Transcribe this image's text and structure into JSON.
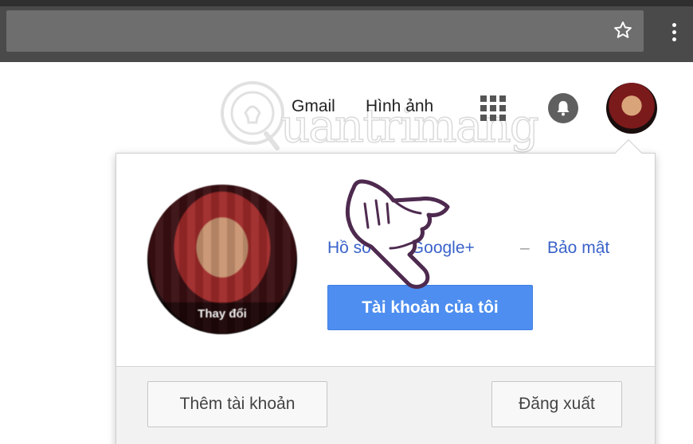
{
  "header": {
    "gmail": "Gmail",
    "images": "Hình ảnh"
  },
  "watermark": {
    "text": "uantrimang"
  },
  "account": {
    "change_photo": "Thay đổi",
    "gplus_link": "Hồ sơ trên Google+",
    "separator": "–",
    "security_link": "Bảo mật",
    "my_account_button": "Tài khoản của tôi"
  },
  "footer": {
    "add_account": "Thêm tài khoản",
    "sign_out": "Đăng xuất"
  },
  "colors": {
    "accent_blue": "#4d8ef0",
    "link_blue": "#3a62c9",
    "browser_dark": "#4a4a4a"
  },
  "icons": [
    "star-icon",
    "more-vert-icon",
    "apps-grid-icon",
    "notification-bell-icon",
    "pointing-hand-icon"
  ]
}
